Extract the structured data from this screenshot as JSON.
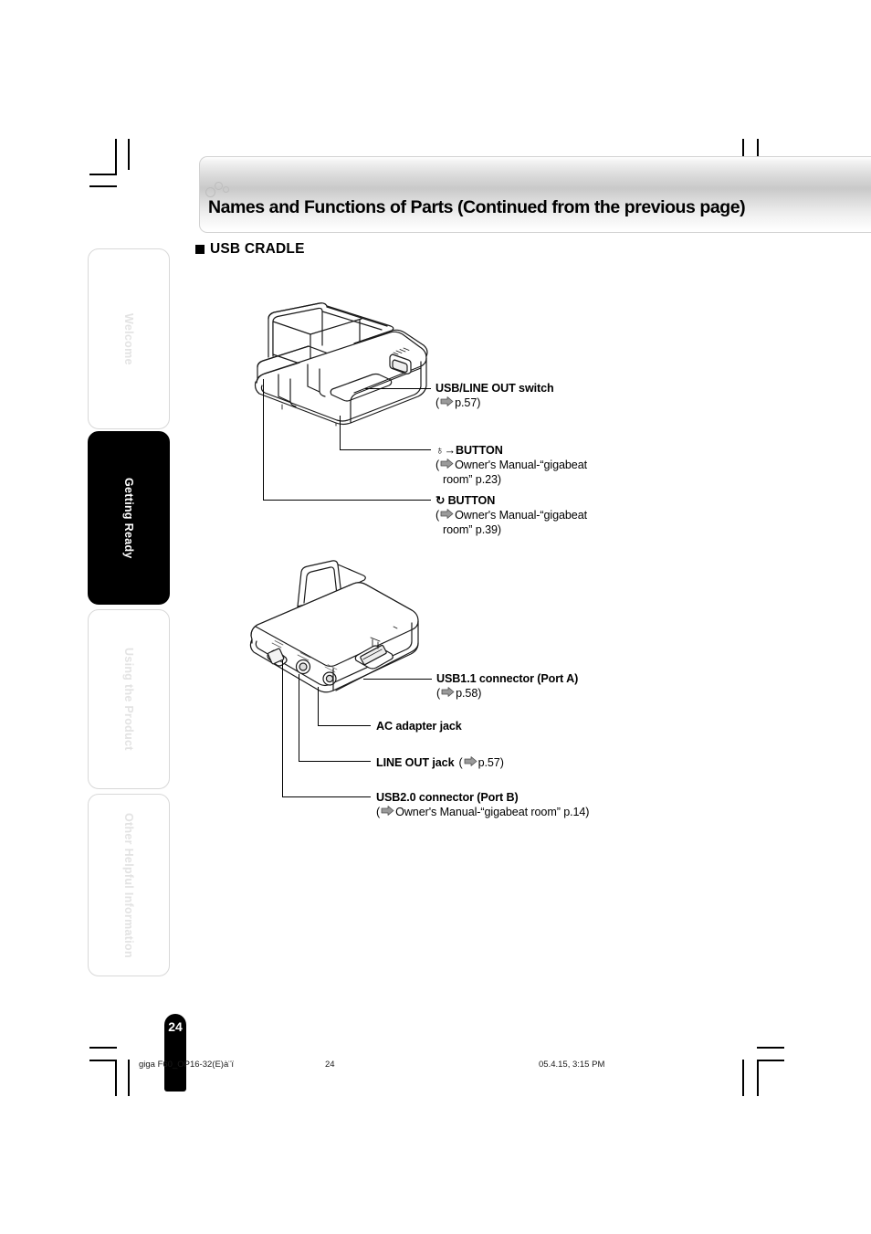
{
  "document": {
    "header_title": "Names and Functions of Parts  (Continued from the previous page)",
    "section_heading": "USB CRADLE",
    "page_number": "24"
  },
  "sidebar": {
    "tabs": [
      {
        "label": "Welcome",
        "active": false
      },
      {
        "label": "Getting Ready",
        "active": true
      },
      {
        "label": "Using the Product",
        "active": false
      },
      {
        "label": "Other Helpful Information",
        "active": false
      }
    ]
  },
  "illustrations": [
    {
      "name": "usb-cradle-front-view",
      "caption": ""
    },
    {
      "name": "usb-cradle-rear-view",
      "caption": ""
    }
  ],
  "callouts_top": [
    {
      "label": "USB/LINE OUT switch",
      "ref_open": "(",
      "ref_icon": "right-arrow-icon",
      "ref_text": "p.57)",
      "ref_text2": "",
      "glyph": ""
    },
    {
      "label": "BUTTON",
      "ref_open": "(",
      "ref_icon": "right-arrow-icon",
      "ref_text": "Owner's Manual-“gigabeat",
      "ref_text2": "room” p.23)",
      "glyph": "♁→"
    },
    {
      "label": "BUTTON",
      "ref_open": "(",
      "ref_icon": "right-arrow-icon",
      "ref_text": "Owner's Manual-“gigabeat",
      "ref_text2": "room” p.39)",
      "glyph": "↻"
    }
  ],
  "callouts_bottom": [
    {
      "label": "USB1.1 connector (Port A)",
      "ref_open": "(",
      "ref_icon": "right-arrow-icon",
      "ref_text": "p.58)",
      "ref_text2": ""
    },
    {
      "label": "AC adapter jack",
      "ref_open": "",
      "ref_icon": "",
      "ref_text": "",
      "ref_text2": ""
    },
    {
      "label": "LINE OUT jack",
      "ref_open": "(",
      "ref_icon": "right-arrow-icon",
      "ref_text": "p.57)",
      "ref_text2": "",
      "inline": true
    },
    {
      "label": "USB2.0 connector (Port B)",
      "ref_open": "(",
      "ref_icon": "right-arrow-icon",
      "ref_text": "Owner's Manual-“gigabeat room” p.14)",
      "ref_text2": ""
    }
  ],
  "footer": {
    "file_name": "giga      F60_OP16-32(E)à¨ï",
    "page": "24",
    "date": "05.4.15, 3:15 PM"
  },
  "colors": {
    "accent": "#000000",
    "tab_inactive_text": "#e3e3e3",
    "band_mid": "#c9c9c9",
    "ref_arrow": "#9a9a9a"
  }
}
